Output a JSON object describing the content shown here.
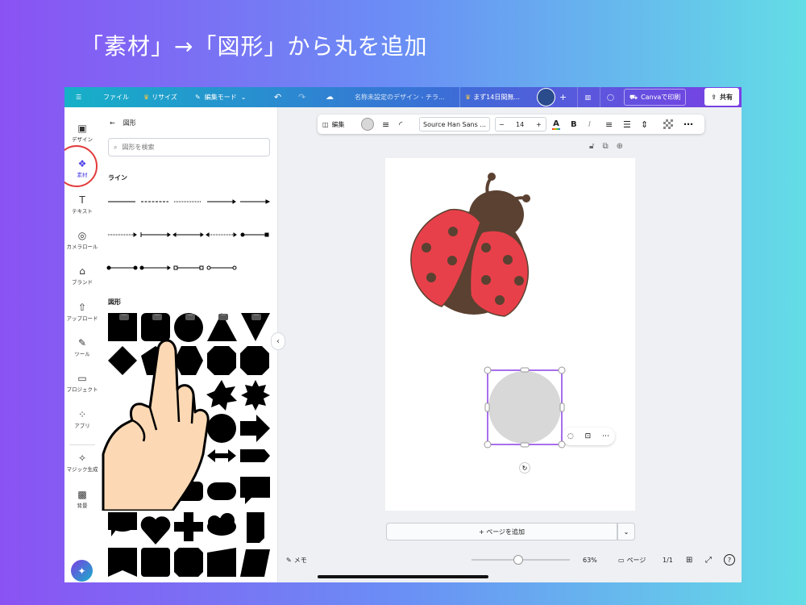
{
  "headline": "「素材」→「図形」から丸を追加",
  "topbar": {
    "menu_icon": "hamburger-icon",
    "file": "ファイル",
    "resize": "リサイズ",
    "edit_mode": "編集モード",
    "doc_title": "名称未設定のデザイン - チラ...",
    "trial": "まず14日間無...",
    "print": "Canvaで印刷",
    "share": "共有"
  },
  "rail": [
    {
      "label": "デザイン",
      "icon": "layout-icon"
    },
    {
      "label": "素材",
      "icon": "elements-icon"
    },
    {
      "label": "テキスト",
      "icon": "text-icon"
    },
    {
      "label": "カメラロール",
      "icon": "camera-icon"
    },
    {
      "label": "ブランド",
      "icon": "brand-icon"
    },
    {
      "label": "アップロード",
      "icon": "upload-icon"
    },
    {
      "label": "ツール",
      "icon": "tools-icon"
    },
    {
      "label": "プロジェクト",
      "icon": "folder-icon"
    },
    {
      "label": "アプリ",
      "icon": "apps-icon"
    },
    {
      "label": "マジック生成",
      "icon": "magic-icon"
    },
    {
      "label": "背景",
      "icon": "background-icon"
    }
  ],
  "panel": {
    "title": "図形",
    "search_placeholder": "図形を検索",
    "lines_title": "ライン",
    "shapes_title": "図形"
  },
  "toolbar": {
    "edit": "編集",
    "font": "Source Han Sans ...",
    "minus": "−",
    "size": "14",
    "plus": "+",
    "bold": "B",
    "italic": "I",
    "more": "⋯"
  },
  "add_page": "+ ページを追加",
  "bottom": {
    "memo": "メモ",
    "zoom": "63%",
    "pages_label": "ページ",
    "page_count": "1/1",
    "zoom_fraction": 0.63
  },
  "colors": {
    "ladybug_red": "#e8404a",
    "ladybug_brown": "#5b4131",
    "circle_gray": "#d8d8d8",
    "selection": "#8b3fe6"
  }
}
